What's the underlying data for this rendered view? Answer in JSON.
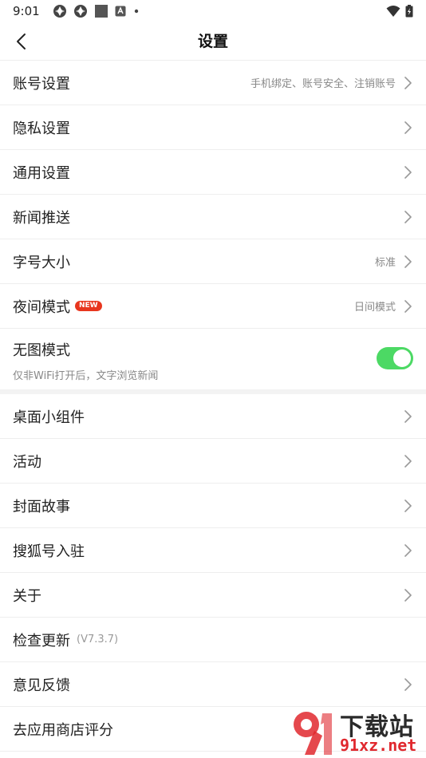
{
  "status_bar": {
    "time": "9:01",
    "left_icons": [
      "app-icon",
      "app-icon",
      "square-icon",
      "notification-icon",
      "dot-icon"
    ],
    "right_icons": [
      "wifi-icon",
      "battery-icon"
    ]
  },
  "nav": {
    "title": "设置"
  },
  "section1": [
    {
      "label": "账号设置",
      "hint": "手机绑定、账号安全、注销账号"
    },
    {
      "label": "隐私设置",
      "hint": ""
    },
    {
      "label": "通用设置",
      "hint": ""
    },
    {
      "label": "新闻推送",
      "hint": ""
    },
    {
      "label": "字号大小",
      "hint": "标准"
    },
    {
      "label": "夜间模式",
      "badge": "NEW",
      "hint": "日间模式"
    }
  ],
  "no_image_mode": {
    "label": "无图模式",
    "description": "仅非WiFi打开后，文字浏览新闻",
    "enabled": true
  },
  "section2": [
    {
      "label": "桌面小组件"
    },
    {
      "label": "活动"
    },
    {
      "label": "封面故事"
    },
    {
      "label": "搜狐号入驻"
    },
    {
      "label": "关于"
    },
    {
      "label": "检查更新",
      "version": "(V7.3.7)"
    },
    {
      "label": "意见反馈"
    },
    {
      "label": "去应用商店评分"
    }
  ],
  "watermark": {
    "top_text": "下载站",
    "bottom_text": "91xz.net"
  },
  "colors": {
    "toggle_on": "#4cd964",
    "badge_red": "#e8361e",
    "hint_gray": "#888888",
    "divider": "#eeeeee"
  }
}
